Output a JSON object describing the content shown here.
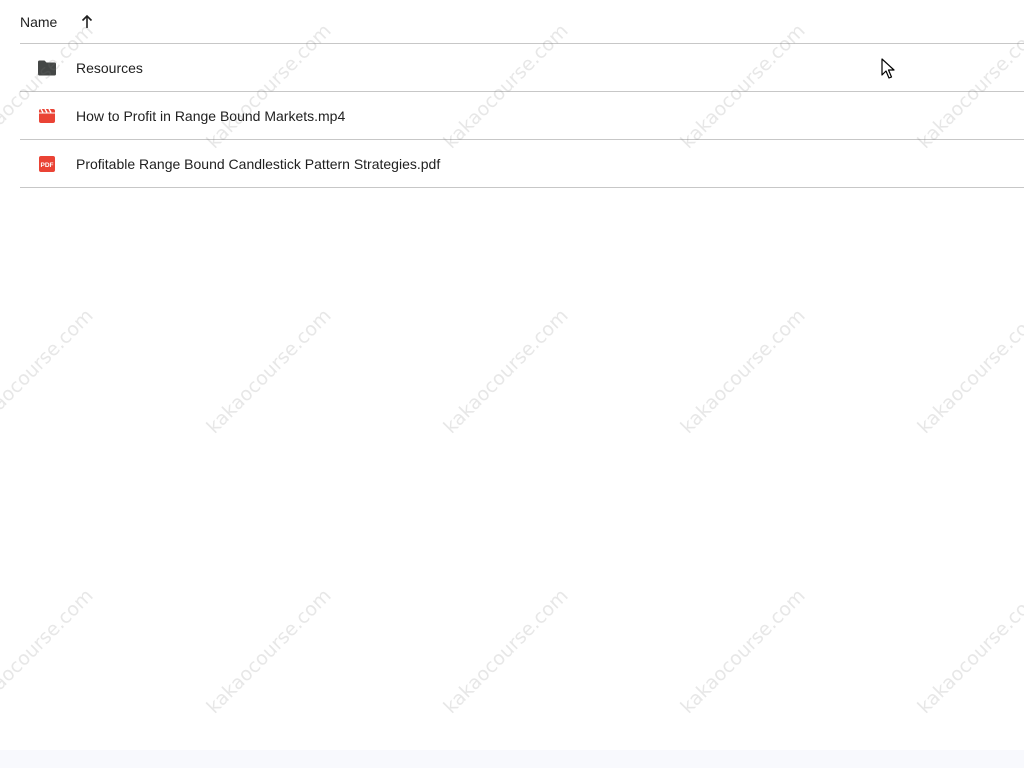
{
  "header": {
    "name_label": "Name",
    "sort_icon": "arrow-up-icon"
  },
  "files": [
    {
      "name": "Resources",
      "icon": "folder-icon",
      "icon_color": "#444746"
    },
    {
      "name": "How to Profit in Range Bound Markets.mp4",
      "icon": "video-icon",
      "icon_color": "#ea4335"
    },
    {
      "name": "Profitable Range Bound Candlestick Pattern Strategies.pdf",
      "icon": "pdf-icon",
      "icon_color": "#ea4335",
      "icon_text": "PDF"
    }
  ],
  "watermark": "kakaocourse.com"
}
